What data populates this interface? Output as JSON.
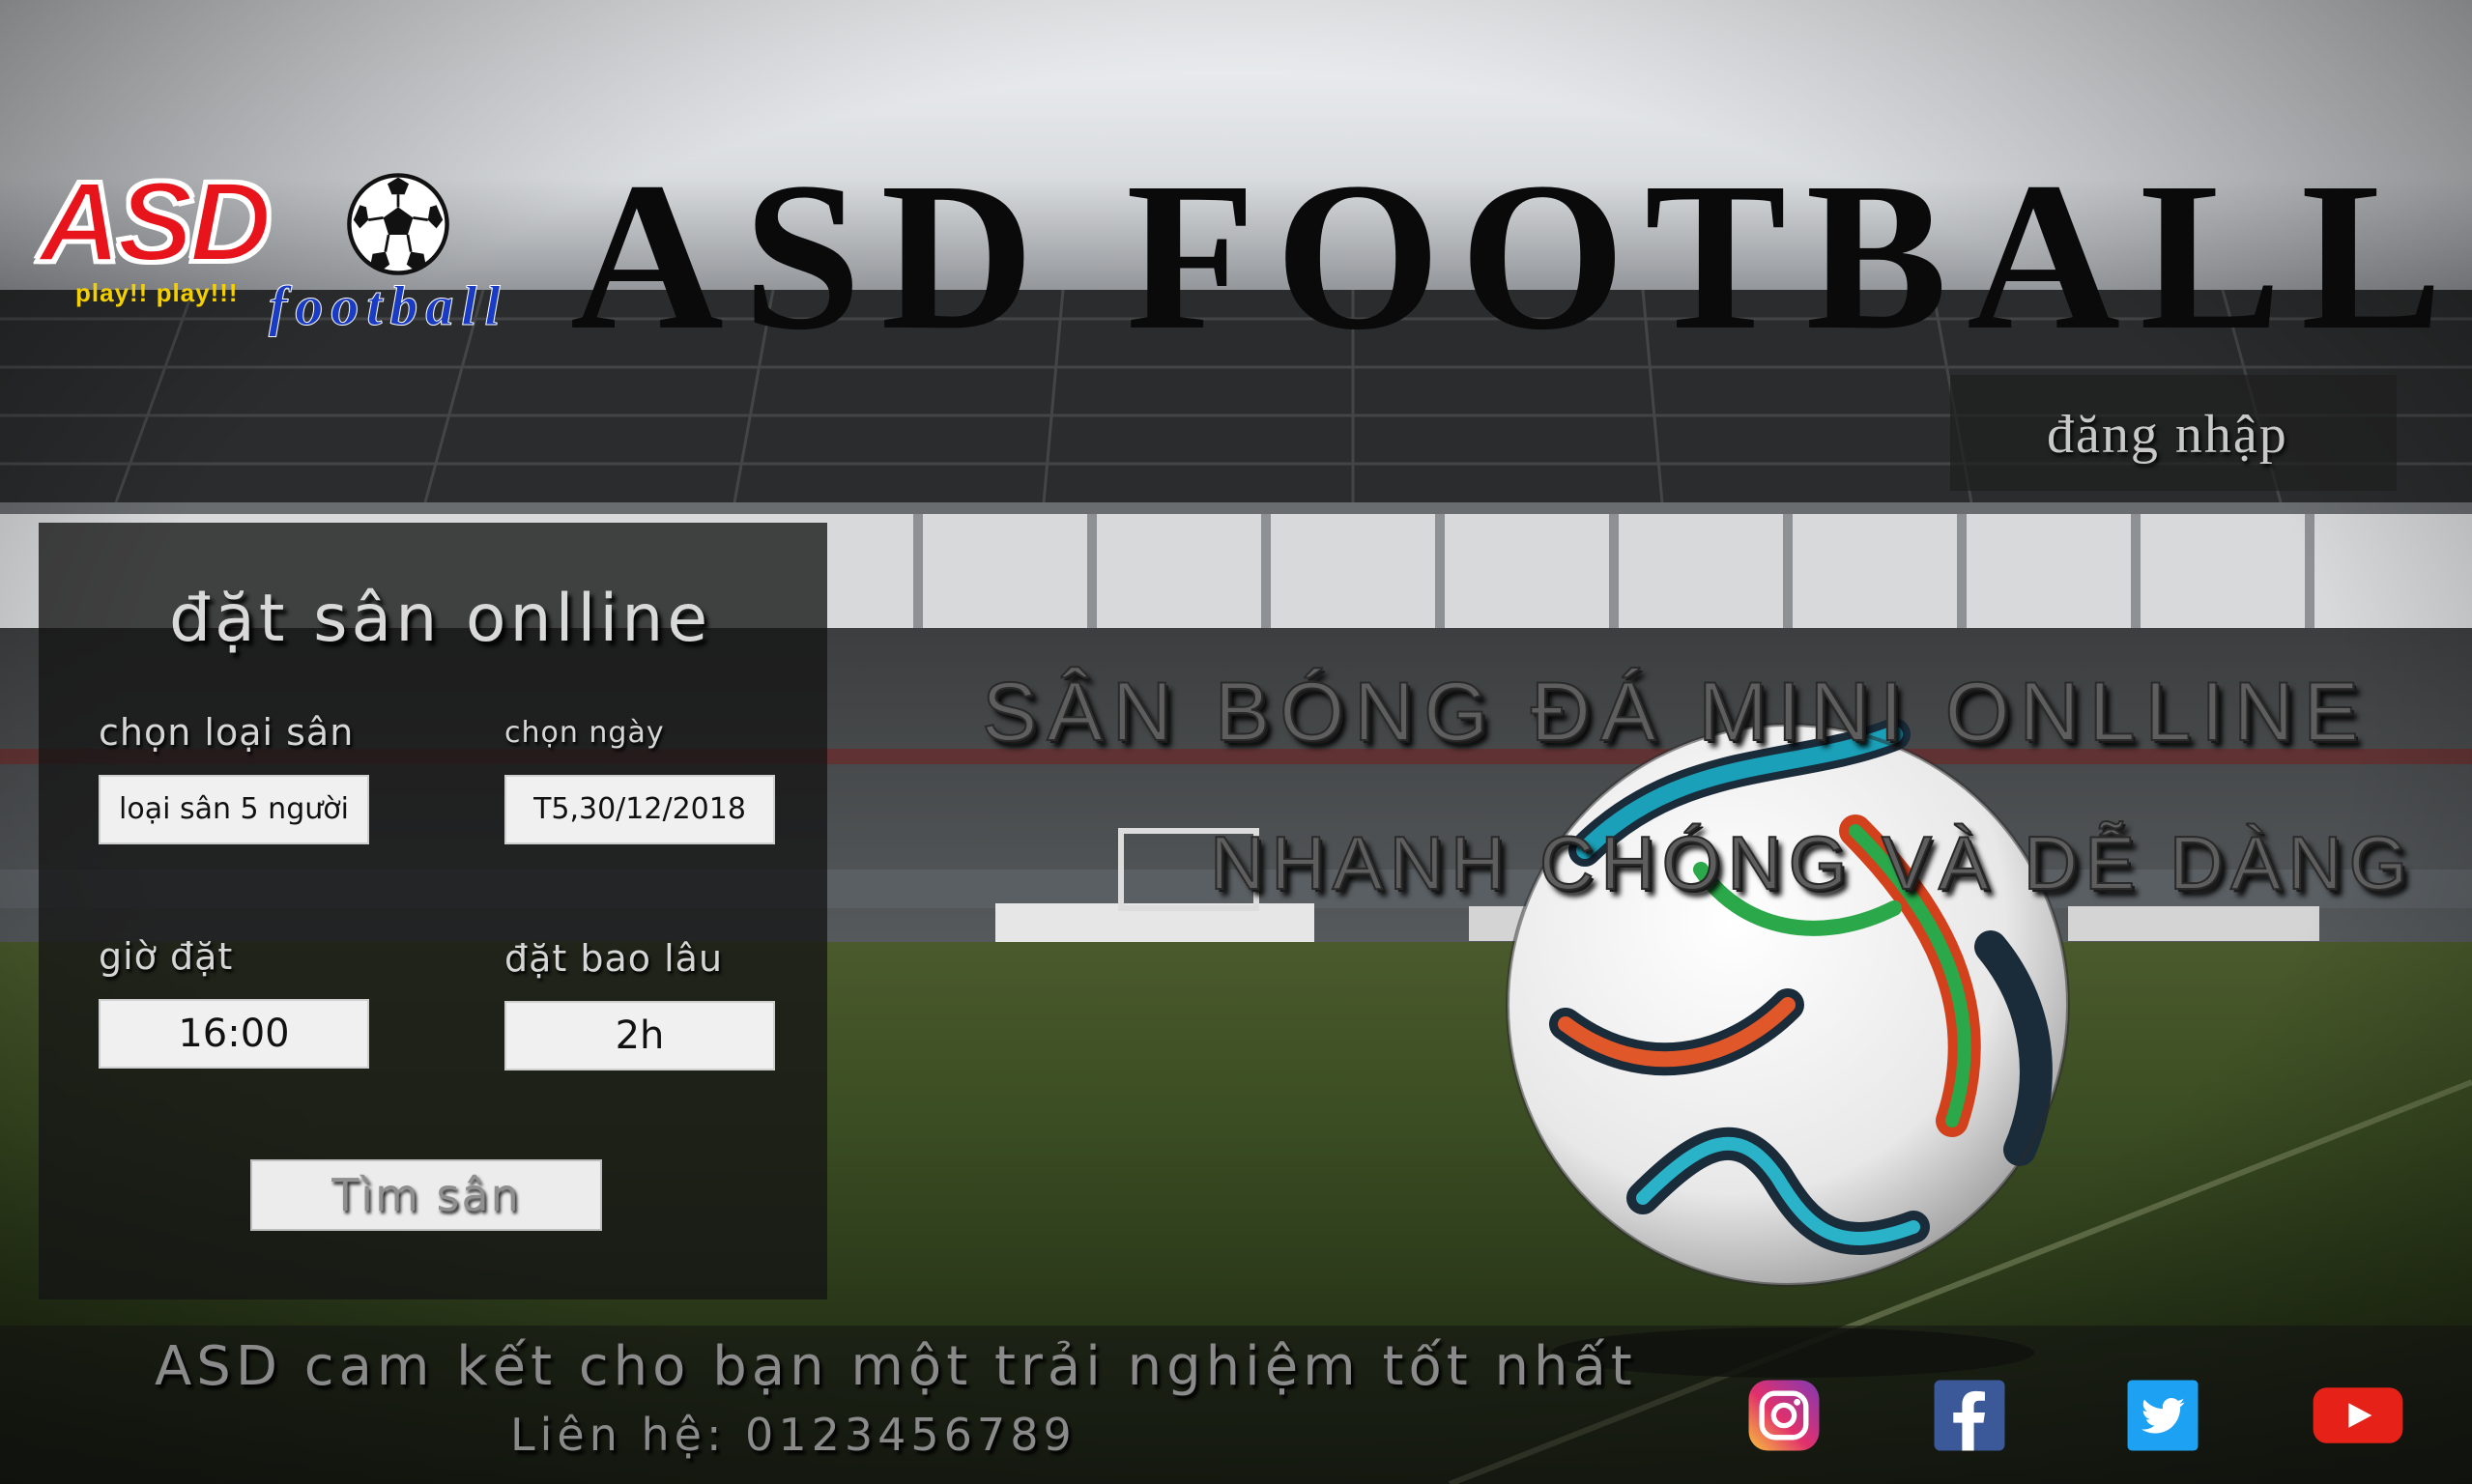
{
  "logo": {
    "brand": "ASD",
    "tagline": "play!! play!!!",
    "subtitle": "football",
    "icon": "soccer-ball-icon"
  },
  "header": {
    "title": "ASD FOOTBALL",
    "login_label": "đăng nhập"
  },
  "booking": {
    "title": "đặt sân onlline",
    "field_type_label": "chọn loại sân",
    "field_type_value": "loại sân 5 người",
    "date_label": "chọn ngày",
    "date_value": "T5,30/12/2018",
    "time_label": "giờ đặt",
    "time_value": "16:00",
    "duration_label": "đặt bao lâu",
    "duration_value": "2h",
    "search_label": "Tìm sân"
  },
  "hero": {
    "line1": "SÂN BÓNG ĐÁ MINI  ONLLINE",
    "line2": "NHANH CHÓNG VÀ DỄ DÀNG"
  },
  "footer": {
    "slogan": "ASD cam kết cho bạn một trải nghiệm tốt nhất",
    "contact": "Liên hệ: 0123456789",
    "social": [
      {
        "name": "instagram-icon",
        "color": "#c13584"
      },
      {
        "name": "facebook-icon",
        "color": "#3b5998"
      },
      {
        "name": "twitter-icon",
        "color": "#1da1f2"
      },
      {
        "name": "youtube-icon",
        "color": "#e62117"
      }
    ]
  }
}
